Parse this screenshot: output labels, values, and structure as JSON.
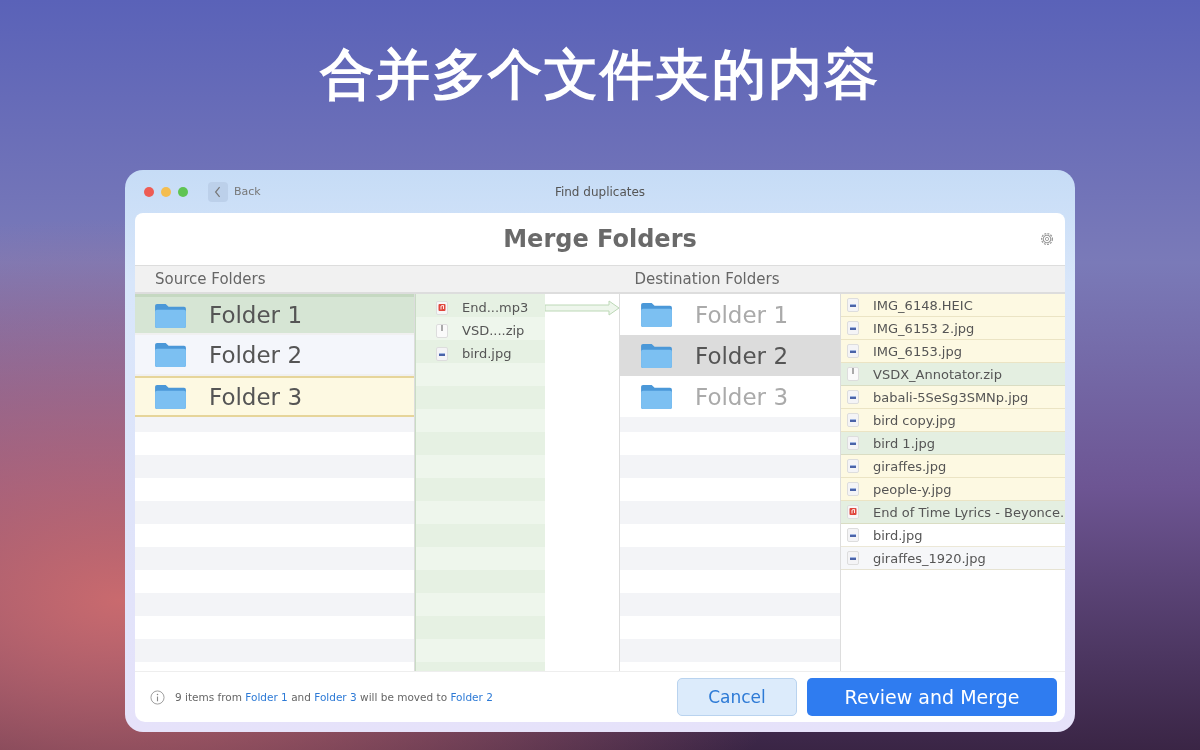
{
  "headline": "合并多个文件夹的内容",
  "window": {
    "title": "Find duplicates",
    "back": "Back"
  },
  "panel": {
    "title": "Merge Folders"
  },
  "source": {
    "header": "Source Folders",
    "folders": [
      {
        "name": "Folder 1",
        "color": "#d6e5d4"
      },
      {
        "name": "Folder 2",
        "color": "#f4f6fb"
      },
      {
        "name": "Folder 3",
        "color": "#fdf9e2"
      }
    ]
  },
  "moving_files": [
    {
      "name": "End...mp3",
      "kind": "audio"
    },
    {
      "name": "VSD....zip",
      "kind": "zip"
    },
    {
      "name": "bird.jpg",
      "kind": "image"
    }
  ],
  "destination": {
    "header": "Destination Folders",
    "folders": [
      {
        "name": "Folder 1",
        "selected": false
      },
      {
        "name": "Folder 2",
        "selected": true
      },
      {
        "name": "Folder 3",
        "selected": false
      }
    ],
    "files": [
      {
        "name": "IMG_6148.HEIC",
        "kind": "image",
        "color": "#fdf9e2"
      },
      {
        "name": "IMG_6153 2.jpg",
        "kind": "image",
        "color": "#fdf9e2"
      },
      {
        "name": "IMG_6153.jpg",
        "kind": "image",
        "color": "#fdf9e2"
      },
      {
        "name": "VSDX_Annotator.zip",
        "kind": "zip",
        "color": "#e4efe1"
      },
      {
        "name": "babali-5SeSg3SMNp.jpg",
        "kind": "image",
        "color": "#fdf9e2"
      },
      {
        "name": "bird copy.jpg",
        "kind": "image",
        "color": "#fdf9e2"
      },
      {
        "name": "bird 1.jpg",
        "kind": "image",
        "color": "#e4efe1"
      },
      {
        "name": "giraffes.jpg",
        "kind": "image",
        "color": "#fdf9e2"
      },
      {
        "name": "people-y.jpg",
        "kind": "image",
        "color": "#fdf9e2"
      },
      {
        "name": "End of Time Lyrics - Beyonce.",
        "kind": "audio",
        "color": "#e4efe1"
      },
      {
        "name": "bird.jpg",
        "kind": "image",
        "color": "#ffffff"
      },
      {
        "name": "giraffes_1920.jpg",
        "kind": "image",
        "color": "#f6f7f9"
      }
    ]
  },
  "footer": {
    "message": [
      {
        "kind": "text",
        "text": "9 items from "
      },
      {
        "kind": "link",
        "text": "Folder 1"
      },
      {
        "kind": "text",
        "text": " and "
      },
      {
        "kind": "link",
        "text": "Folder 3"
      },
      {
        "kind": "text",
        "text": " will be moved to "
      },
      {
        "kind": "link",
        "text": "Folder 2"
      }
    ],
    "cancel": "Cancel",
    "confirm": "Review and Merge"
  }
}
